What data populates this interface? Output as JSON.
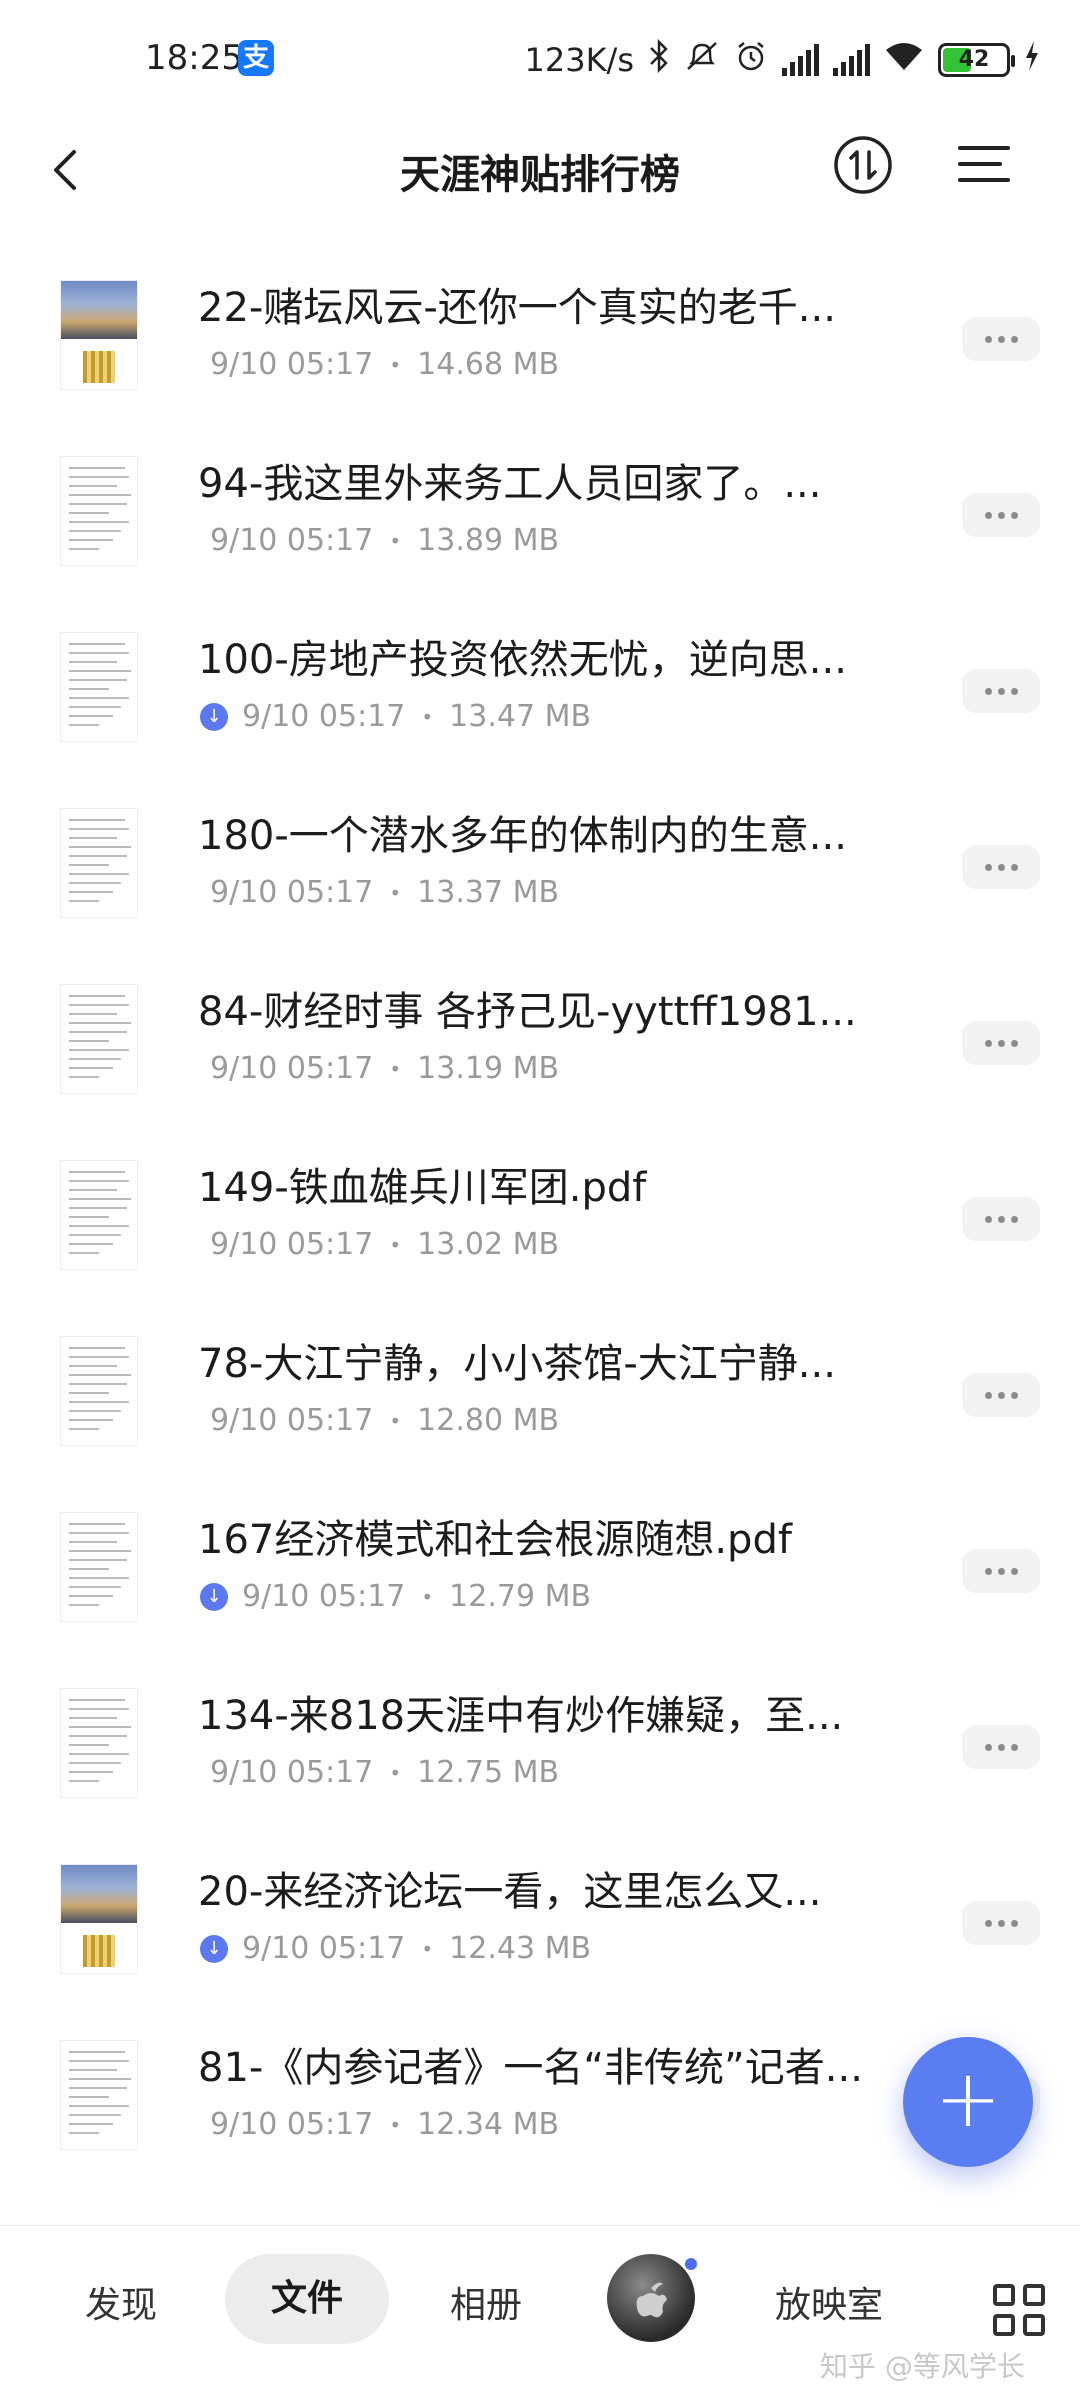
{
  "status_bar": {
    "time": "18:25",
    "alipay_glyph": "支",
    "net_speed": "123K/s",
    "battery": "42",
    "icons": [
      "bluetooth-icon",
      "mute-icon",
      "alarm-icon",
      "signal-hd-icon",
      "signal-hd-icon",
      "wifi-icon",
      "battery-icon",
      "charging-icon"
    ]
  },
  "header": {
    "title": "天涯神贴排行榜"
  },
  "files": [
    {
      "name": "22-赌坛风云-还你一个真实的老千...",
      "date": "9/10 05:17",
      "size": "14.68 MB",
      "downloaded": false,
      "thumb": "photo"
    },
    {
      "name": "94-我这里外来务工人员回家了。...",
      "date": "9/10 05:17",
      "size": "13.89 MB",
      "downloaded": false,
      "thumb": "doc"
    },
    {
      "name": "100-房地产投资依然无忧，逆向思...",
      "date": "9/10 05:17",
      "size": "13.47 MB",
      "downloaded": true,
      "thumb": "doc"
    },
    {
      "name": "180-一个潜水多年的体制内的生意...",
      "date": "9/10 05:17",
      "size": "13.37 MB",
      "downloaded": false,
      "thumb": "doc"
    },
    {
      "name": "84-财经时事 各抒己见-yyttff1981...",
      "date": "9/10 05:17",
      "size": "13.19 MB",
      "downloaded": false,
      "thumb": "doc"
    },
    {
      "name": "149-铁血雄兵川军团.pdf",
      "date": "9/10 05:17",
      "size": "13.02 MB",
      "downloaded": false,
      "thumb": "doc"
    },
    {
      "name": "78-大江宁静，小小茶馆-大江宁静...",
      "date": "9/10 05:17",
      "size": "12.80 MB",
      "downloaded": false,
      "thumb": "doc"
    },
    {
      "name": "167经济模式和社会根源随想.pdf",
      "date": "9/10 05:17",
      "size": "12.79 MB",
      "downloaded": true,
      "thumb": "doc"
    },
    {
      "name": "134-来818天涯中有炒作嫌疑，至...",
      "date": "9/10 05:17",
      "size": "12.75 MB",
      "downloaded": false,
      "thumb": "doc"
    },
    {
      "name": "20-来经济论坛一看，这里怎么又...",
      "date": "9/10 05:17",
      "size": "12.43 MB",
      "downloaded": true,
      "thumb": "photo"
    },
    {
      "name": "81-《内参记者》一名“非传统”记者...",
      "date": "9/10 05:17",
      "size": "12.34 MB",
      "downloaded": false,
      "thumb": "doc"
    }
  ],
  "fab": {
    "label": "+"
  },
  "bottom_nav": {
    "discover": "发现",
    "files": "文件",
    "album": "相册",
    "cinema": "放映室",
    "active": "文件"
  },
  "watermark": "知乎 @等风学长"
}
